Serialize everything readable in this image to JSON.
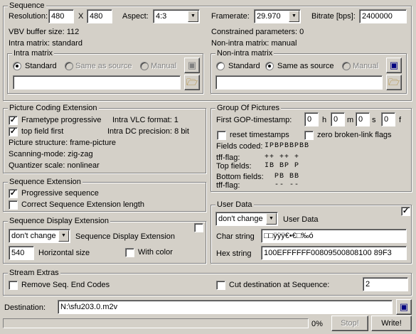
{
  "sequence": {
    "title": "Sequence",
    "resolution_label": "Resolution:",
    "width": "480",
    "x_label": "X",
    "height": "480",
    "aspect_label": "Aspect:",
    "aspect_value": "4:3",
    "framerate_label": "Framerate:",
    "framerate_value": "29.970",
    "bitrate_label": "Bitrate [bps]:",
    "bitrate_value": "2400000",
    "vbv": "VBV buffer size: 112",
    "constrained": "Constrained parameters: 0",
    "intra_matrix_text": "Intra matrix: standard",
    "nonintra_matrix_text": "Non-intra matrix: manual",
    "intra_group": {
      "title": "Intra matrix",
      "standard": "Standard",
      "same": "Same as source",
      "manual": "Manual",
      "value": ""
    },
    "nonintra_group": {
      "title": "Non-intra matrix",
      "standard": "Standard",
      "same": "Same as source",
      "manual": "Manual",
      "value": ""
    }
  },
  "pce": {
    "title": "Picture Coding Extension",
    "frametype": "Frametype progressive",
    "intra_vlc": "Intra VLC format: 1",
    "top_field": "top field first",
    "intra_dc": "Intra DC precision: 8 bit",
    "structure": "Picture structure: frame-picture",
    "scanning": "Scanning-mode: zig-zag",
    "quantizer": "Quantizer scale: nonlinear"
  },
  "gop": {
    "title": "Group Of Pictures",
    "timestamp_label": "First GOP-timestamp:",
    "h": "0",
    "h_unit": "h",
    "m": "0",
    "m_unit": "m",
    "s": "0",
    "s_unit": "s",
    "f": "0",
    "f_unit": "f",
    "reset": "reset timestamps",
    "zero": "zero broken-link flags",
    "fields_coded_label": "Fields coded:",
    "fields_coded": "IPBPBBPBB",
    "tff_label": "tff-flag:",
    "tff_row1": "++  ++  +",
    "top_label": "Top fields:",
    "top_row": "IB  BP  P",
    "bottom_label": "Bottom fields:",
    "bottom_row": "PB  BB",
    "tff_label2": "tff-flag:",
    "tff_row2": "--  --"
  },
  "seqext": {
    "title": "Sequence Extension",
    "progressive": "Progressive sequence",
    "correct": "Correct Sequence Extension length"
  },
  "seqdisp": {
    "title": "Sequence Display Extension",
    "select": "don't change",
    "label": "Sequence Display Extension",
    "hsize": "540",
    "hsize_label": "Horizontal size",
    "color": "With color"
  },
  "userdata": {
    "title": "User Data",
    "select": "don't change",
    "label": "User Data",
    "char_label": "Char string",
    "char_value": "□□ÿÿÿ€•€□‰ó",
    "hex_label": "Hex string",
    "hex_value": "100EFFFFFF00809500808100 89F3"
  },
  "extras": {
    "title": "Stream Extras",
    "remove": "Remove Seq. End Codes",
    "cut": "Cut destination at Sequence:",
    "cut_value": "2"
  },
  "destination": {
    "label": "Destination:",
    "value": "N:\\sfu203.0.m2v"
  },
  "footer": {
    "progress": 0,
    "percent": "0%",
    "stop": "Stop!",
    "write": "Write!"
  },
  "icons": {
    "save": "floppy-icon",
    "open": "folder-open-icon"
  }
}
